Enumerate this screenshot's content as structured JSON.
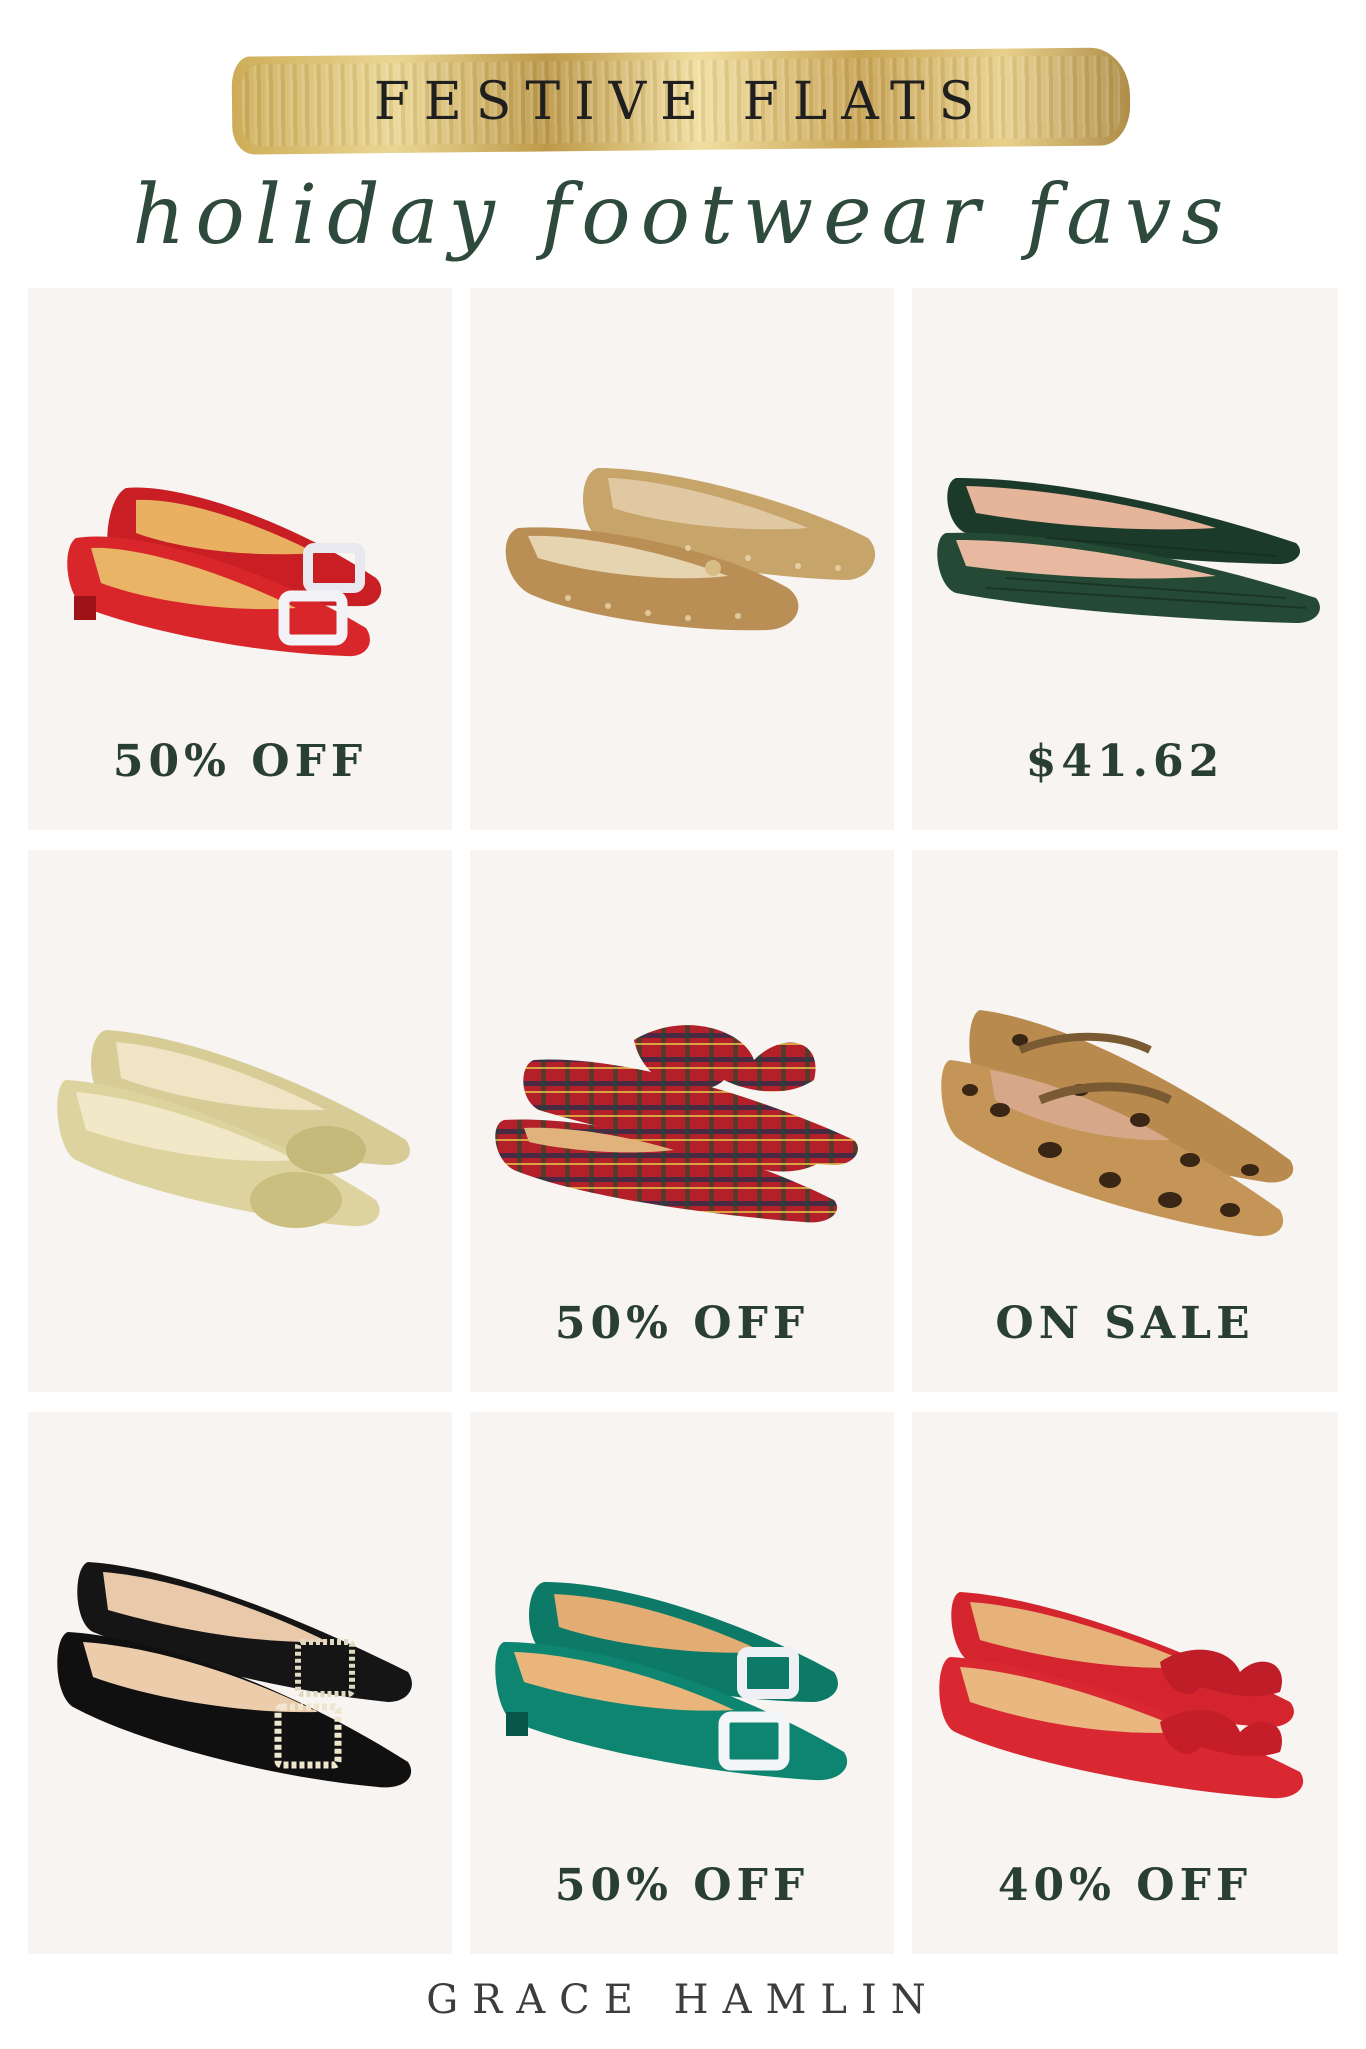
{
  "header": {
    "title": "FESTIVE FLATS",
    "subtitle": "holiday footwear favs"
  },
  "products": [
    {
      "label": "50% OFF",
      "shoe": "red-satin-crystal-buckle-flats-image",
      "color": "#d8262b"
    },
    {
      "label": "",
      "shoe": "gold-sequin-ballet-flats-image",
      "color": "#c9a36a"
    },
    {
      "label": "$41.62",
      "shoe": "green-croc-pointed-flats-image",
      "color": "#1f3d2c"
    },
    {
      "label": "",
      "shoe": "gold-metallic-bow-flats-image",
      "color": "#d9cf9c"
    },
    {
      "label": "50% OFF",
      "shoe": "red-tartan-bow-mules-image",
      "color": "#b3202a"
    },
    {
      "label": "ON SALE",
      "shoe": "leopard-calf-hair-mary-jane-flats-image",
      "color": "#b98a4e"
    },
    {
      "label": "",
      "shoe": "black-velvet-crystal-bow-flats-image",
      "color": "#141414"
    },
    {
      "label": "50% OFF",
      "shoe": "emerald-satin-crystal-buckle-flats-image",
      "color": "#0e7e6a"
    },
    {
      "label": "40% OFF",
      "shoe": "red-suede-bow-flats-image",
      "color": "#d4252f"
    }
  ],
  "footer": {
    "brand": "GRACE HAMLIN"
  },
  "colors": {
    "card_bg": "#f7f4f1",
    "label_text": "#2a3f33",
    "script_green": "#2e4a3c",
    "gold": "#d6b55f"
  }
}
